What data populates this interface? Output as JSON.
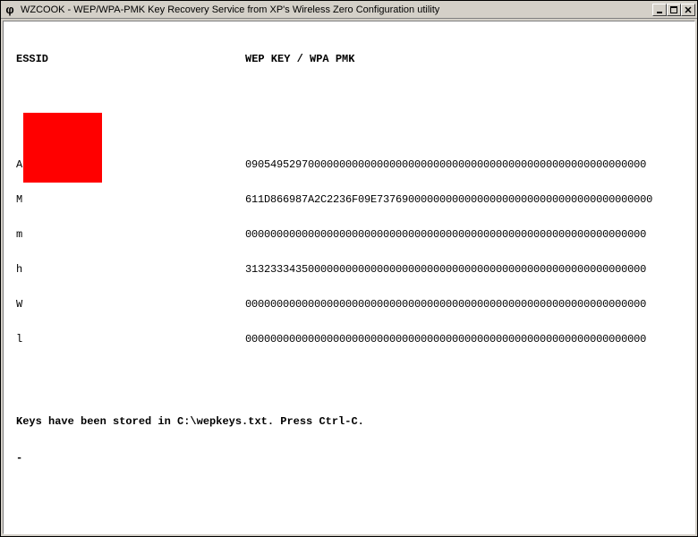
{
  "window": {
    "title": "WZCOOK - WEP/WPA-PMK Key Recovery Service from XP's Wireless Zero Configuration utility",
    "icon_glyph": "φ"
  },
  "headers": {
    "essid": "ESSID",
    "key": "WEP KEY / WPA PMK"
  },
  "rows": [
    {
      "essid_first": "A",
      "key": "0905495297000000000000000000000000000000000000000000000000000000"
    },
    {
      "essid_first": "M",
      "key": "611D866987A2C2236F09E73769000000000000000000000000000000000000000"
    },
    {
      "essid_first": "m",
      "key": "0000000000000000000000000000000000000000000000000000000000000000"
    },
    {
      "essid_first": "h",
      "key": "3132333435000000000000000000000000000000000000000000000000000000"
    },
    {
      "essid_first": "W",
      "key": "0000000000000000000000000000000000000000000000000000000000000000"
    },
    {
      "essid_first": "l",
      "key": "0000000000000000000000000000000000000000000000000000000000000000"
    }
  ],
  "status": "Keys have been stored in C:\\wepkeys.txt. Press Ctrl-C.",
  "cursor": "-"
}
